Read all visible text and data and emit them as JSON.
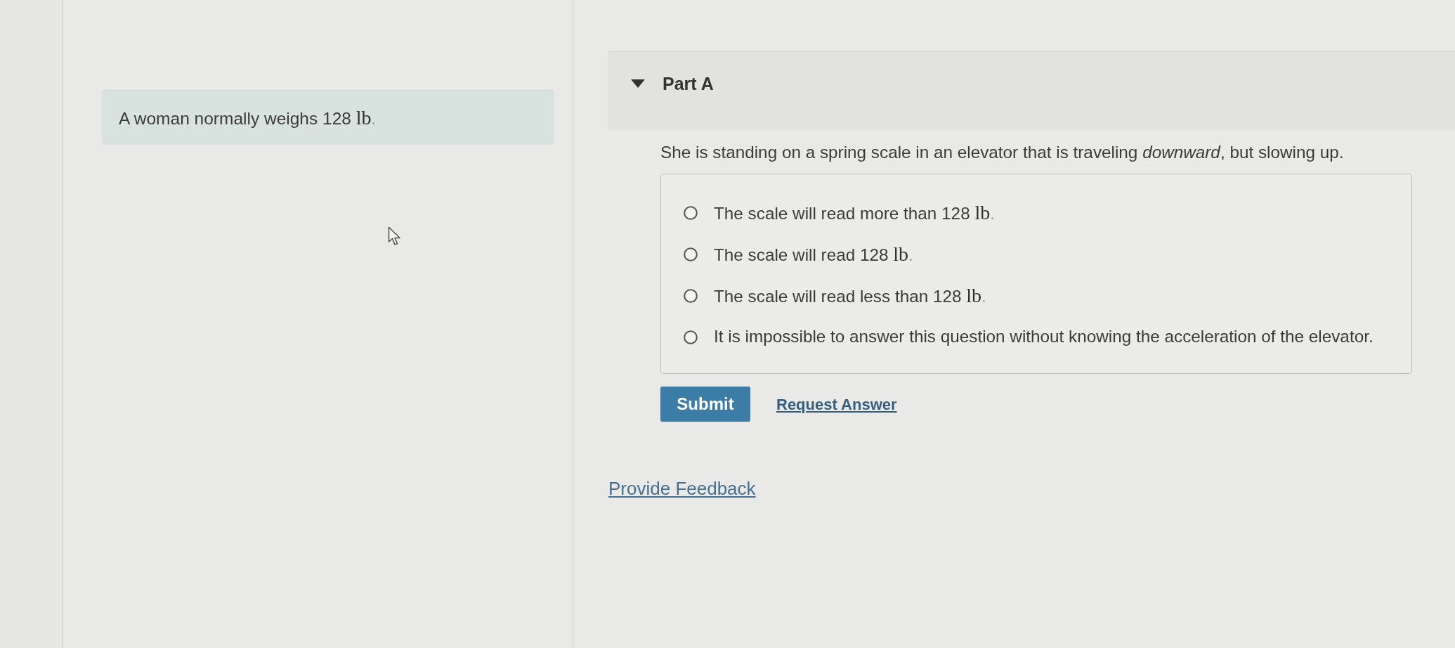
{
  "intro": {
    "text": "A woman normally weighs 128",
    "unit": "lb",
    "end": "."
  },
  "part": {
    "title": "Part A",
    "expanded": true,
    "question": "She is standing on a spring scale in an elevator that is traveling *downward*, but slowing up.",
    "options": [
      {
        "text": "The scale will read more than 128",
        "unit": "lb",
        "end": ".",
        "selected": false
      },
      {
        "text": "The scale will read 128",
        "unit": "lb",
        "end": ".",
        "selected": false
      },
      {
        "text": "The scale will read less than 128",
        "unit": "lb",
        "end": ".",
        "selected": false
      },
      {
        "text": "It is impossible to answer this question without knowing the acceleration of the elevator.",
        "selected": false
      }
    ],
    "submit": "Submit",
    "request_answer": "Request Answer"
  },
  "feedback_link": "Provide Feedback"
}
